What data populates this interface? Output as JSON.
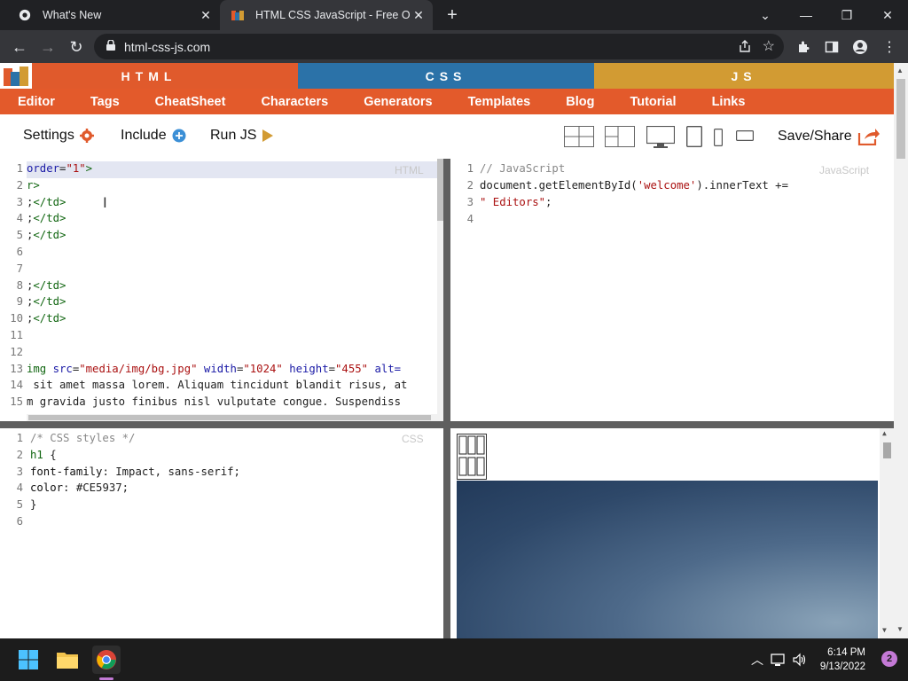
{
  "browser": {
    "tabs": [
      {
        "title": "What's New",
        "active": false
      },
      {
        "title": "HTML CSS JavaScript - Free Onlin",
        "active": true
      }
    ],
    "url": "html-css-js.com",
    "new_tab_label": "+"
  },
  "site": {
    "lang_tabs": [
      "HTML",
      "CSS",
      "JS"
    ],
    "menu": [
      "Editor",
      "Tags",
      "CheatSheet",
      "Characters",
      "Generators",
      "Templates",
      "Blog",
      "Tutorial",
      "Links"
    ],
    "toolbar": {
      "settings": "Settings",
      "include": "Include",
      "run": "Run JS",
      "save": "Save/Share"
    },
    "html_pane": {
      "watermark": "HTML",
      "lines": [
        {
          "n": "1",
          "segments": [
            {
              "c": "attr",
              "t": "order"
            },
            {
              "c": "plain",
              "t": "="
            },
            {
              "c": "str",
              "t": "\"1\""
            },
            {
              "c": "tag",
              "t": ">"
            }
          ]
        },
        {
          "n": "2",
          "segments": [
            {
              "c": "tag",
              "t": "r>"
            }
          ]
        },
        {
          "n": "3",
          "segments": [
            {
              "c": "plain",
              "t": ";"
            },
            {
              "c": "tag",
              "t": "</td>"
            }
          ]
        },
        {
          "n": "4",
          "segments": [
            {
              "c": "plain",
              "t": ";"
            },
            {
              "c": "tag",
              "t": "</td>"
            }
          ]
        },
        {
          "n": "5",
          "segments": [
            {
              "c": "plain",
              "t": ";"
            },
            {
              "c": "tag",
              "t": "</td>"
            }
          ]
        },
        {
          "n": "6",
          "segments": []
        },
        {
          "n": "7",
          "segments": []
        },
        {
          "n": "8",
          "segments": [
            {
              "c": "plain",
              "t": ";"
            },
            {
              "c": "tag",
              "t": "</td>"
            }
          ]
        },
        {
          "n": "9",
          "segments": [
            {
              "c": "plain",
              "t": ";"
            },
            {
              "c": "tag",
              "t": "</td>"
            }
          ]
        },
        {
          "n": "10",
          "segments": [
            {
              "c": "plain",
              "t": ";"
            },
            {
              "c": "tag",
              "t": "</td>"
            }
          ]
        },
        {
          "n": "11",
          "segments": []
        },
        {
          "n": "12",
          "segments": []
        },
        {
          "n": "13",
          "segments": [
            {
              "c": "tag",
              "t": "img "
            },
            {
              "c": "attr",
              "t": "src"
            },
            {
              "c": "plain",
              "t": "="
            },
            {
              "c": "str",
              "t": "\"media/img/bg.jpg\""
            },
            {
              "c": "plain",
              "t": " "
            },
            {
              "c": "attr",
              "t": "width"
            },
            {
              "c": "plain",
              "t": "="
            },
            {
              "c": "str",
              "t": "\"1024\""
            },
            {
              "c": "plain",
              "t": " "
            },
            {
              "c": "attr",
              "t": "height"
            },
            {
              "c": "plain",
              "t": "="
            },
            {
              "c": "str",
              "t": "\"455\""
            },
            {
              "c": "plain",
              "t": " "
            },
            {
              "c": "attr",
              "t": "alt="
            }
          ]
        },
        {
          "n": "14",
          "segments": [
            {
              "c": "plain",
              "t": " sit amet massa lorem. Aliquam tincidunt blandit risus, at"
            }
          ]
        },
        {
          "n": "15",
          "segments": [
            {
              "c": "plain",
              "t": "m gravida justo finibus nisl vulputate congue. Suspendiss"
            }
          ]
        }
      ]
    },
    "js_pane": {
      "watermark": "JavaScript",
      "lines": [
        {
          "n": "1",
          "segments": [
            {
              "c": "com",
              "t": "// JavaScript"
            }
          ]
        },
        {
          "n": "2",
          "segments": [
            {
              "c": "plain",
              "t": "document.getElementById("
            },
            {
              "c": "str",
              "t": "'welcome'"
            },
            {
              "c": "plain",
              "t": ").innerText +="
            }
          ]
        },
        {
          "n": "3",
          "segments": [
            {
              "c": "str",
              "t": "\" Editors\""
            },
            {
              "c": "plain",
              "t": ";"
            }
          ]
        },
        {
          "n": "4",
          "segments": []
        }
      ]
    },
    "css_pane": {
      "watermark": "CSS",
      "lines": [
        {
          "n": "1",
          "segments": [
            {
              "c": "com",
              "t": "/* CSS styles */"
            }
          ]
        },
        {
          "n": "2",
          "segments": [
            {
              "c": "tag",
              "t": "h1"
            },
            {
              "c": "plain",
              "t": " {"
            }
          ]
        },
        {
          "n": "3",
          "segments": [
            {
              "c": "prop",
              "t": "font-family"
            },
            {
              "c": "plain",
              "t": ": Impact, sans-serif;"
            }
          ]
        },
        {
          "n": "4",
          "segments": [
            {
              "c": "prop",
              "t": "color"
            },
            {
              "c": "plain",
              "t": ": #CE5937;"
            }
          ]
        },
        {
          "n": "5",
          "segments": [
            {
              "c": "plain",
              "t": "}"
            }
          ]
        },
        {
          "n": "6",
          "segments": []
        }
      ]
    }
  },
  "taskbar": {
    "time": "6:14 PM",
    "date": "9/13/2022",
    "notifications": "2"
  },
  "colors": {
    "html": "#e05a2c",
    "css": "#2b72a8",
    "js": "#d29b33",
    "menu": "#e35a2b"
  }
}
